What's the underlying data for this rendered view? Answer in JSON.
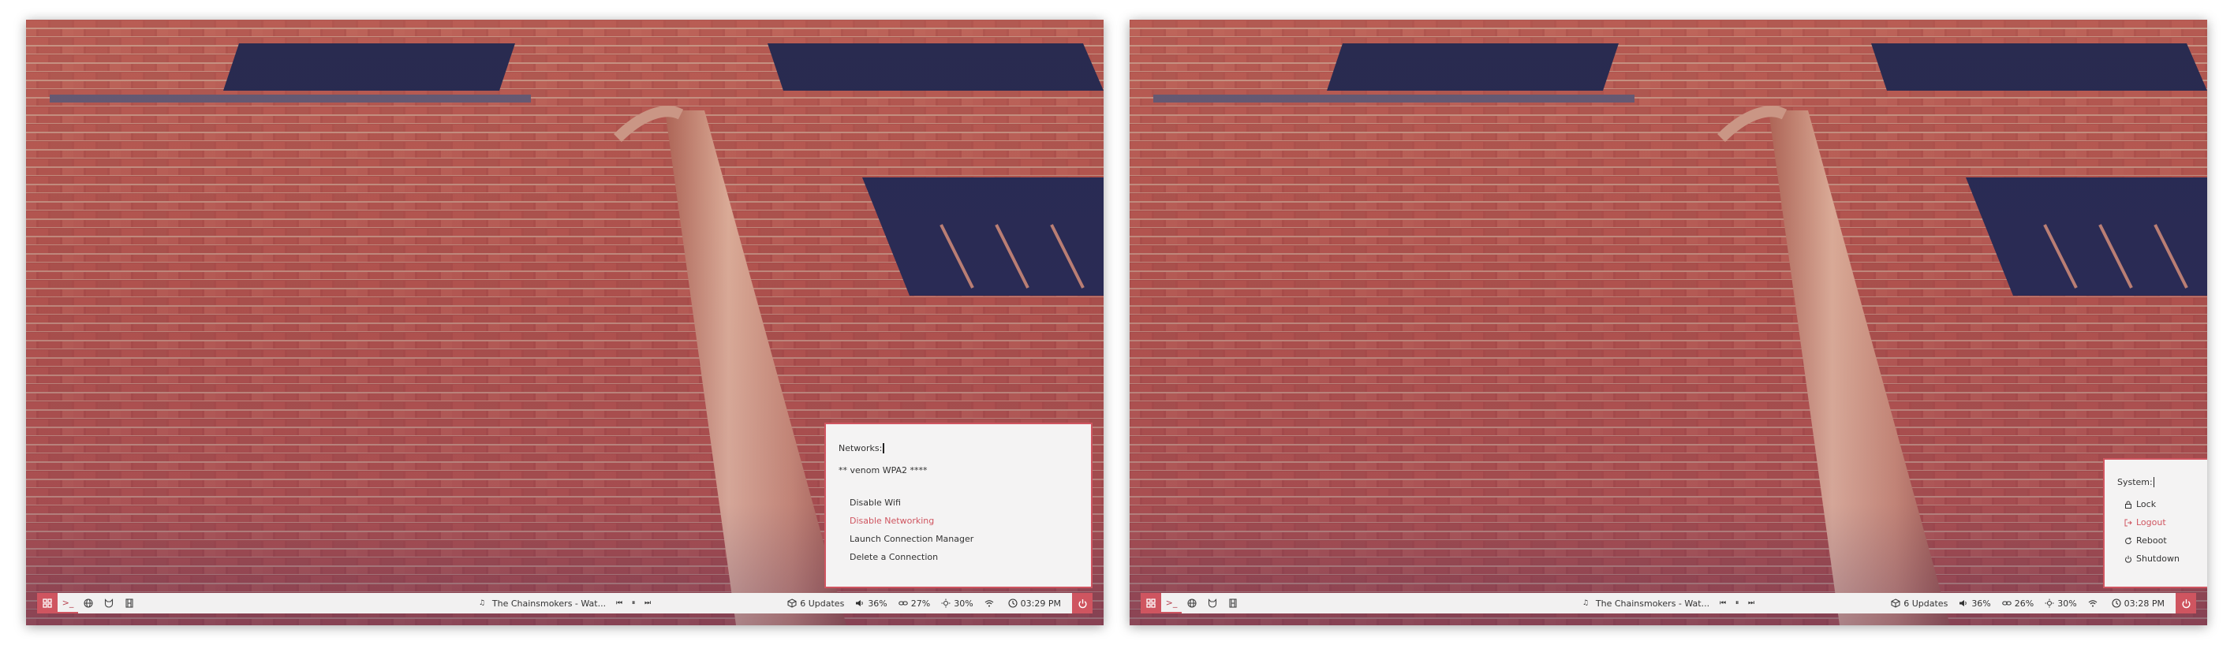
{
  "colors": {
    "accent": "#cf5560",
    "bar_bg": "#f2f1f1",
    "menu_bg": "#f4f3f3",
    "text": "#333333"
  },
  "screens": [
    {
      "id": "left",
      "bar": {
        "workspaces": [
          {
            "icon": "grid-icon",
            "active": true
          },
          {
            "icon": "terminal-icon",
            "label": ">_",
            "underline": true
          },
          {
            "icon": "globe-icon"
          },
          {
            "icon": "cat-icon"
          },
          {
            "icon": "film-icon"
          }
        ],
        "media": {
          "icon": "music-note-icon",
          "title": "The Chainsmokers - Wat...",
          "controls": [
            "previous-icon",
            "pause-icon",
            "next-icon"
          ]
        },
        "updates": "6 Updates",
        "volume": "36%",
        "network_percent": "27%",
        "brightness": "30%",
        "time": "03:29 PM"
      },
      "menu": {
        "prompt": "Networks:",
        "header": "** venom WPA2 ****",
        "items": [
          {
            "label": "Disable Wifi",
            "selected": false
          },
          {
            "label": "Disable Networking",
            "selected": true
          },
          {
            "label": "Launch Connection Manager",
            "selected": false
          },
          {
            "label": "Delete a Connection",
            "selected": false
          }
        ]
      }
    },
    {
      "id": "right",
      "bar": {
        "workspaces": [
          {
            "icon": "grid-icon",
            "active": true
          },
          {
            "icon": "terminal-icon",
            "label": ">_",
            "underline": true
          },
          {
            "icon": "globe-icon"
          },
          {
            "icon": "cat-icon"
          },
          {
            "icon": "film-icon"
          }
        ],
        "media": {
          "icon": "music-note-icon",
          "title": "The Chainsmokers - Wat...",
          "controls": [
            "previous-icon",
            "pause-icon",
            "next-icon"
          ]
        },
        "updates": "6 Updates",
        "volume": "36%",
        "network_percent": "26%",
        "brightness": "30%",
        "time": "03:28 PM"
      },
      "menu": {
        "prompt": "System:",
        "items": [
          {
            "label": "Lock",
            "icon": "lock-icon",
            "selected": false
          },
          {
            "label": "Logout",
            "icon": "logout-icon",
            "selected": true
          },
          {
            "label": "Reboot",
            "icon": "reboot-icon",
            "selected": false
          },
          {
            "label": "Shutdown",
            "icon": "power-icon",
            "selected": false
          }
        ]
      }
    }
  ]
}
